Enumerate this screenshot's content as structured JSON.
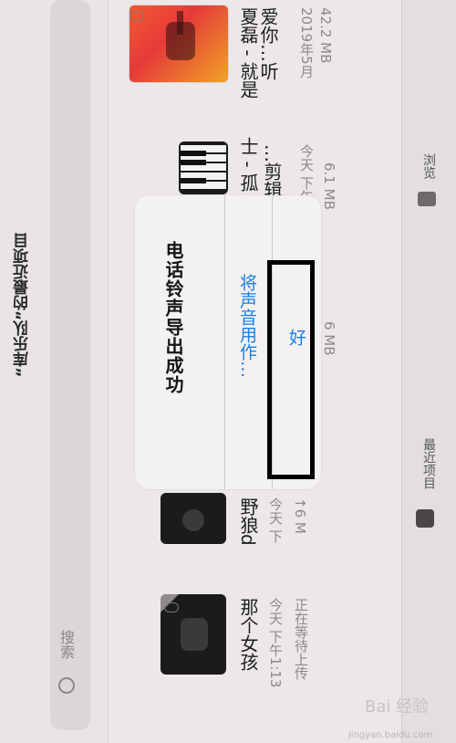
{
  "sidebar": {
    "title": "“库乐队”的最近项目",
    "search_placeholder": "搜索"
  },
  "items": [
    {
      "name": "夏磊 - 就是",
      "sub": "爱你…听",
      "date": "2019年5月",
      "size": "42.2 MB"
    },
    {
      "name": "士 - 孤",
      "sub": "…剪辑",
      "date": "今天 下午11…",
      "size": "6.1 MB"
    },
    {
      "size": "6 MB"
    },
    {
      "name": "野狼d",
      "date": "今天 下",
      "size": "↑6 M"
    },
    {
      "name": "那个女孩",
      "date": "今天 下午1:13",
      "status": "正在等待上传"
    }
  ],
  "tabs": {
    "browse": "浏览",
    "recent": "最近项目"
  },
  "alert": {
    "title": "电话铃声导出成功",
    "button_use_as": "将声音用作…",
    "button_ok": "好"
  },
  "watermark": {
    "main": "Bai 经验",
    "url": "jingyan.baidu.com"
  }
}
